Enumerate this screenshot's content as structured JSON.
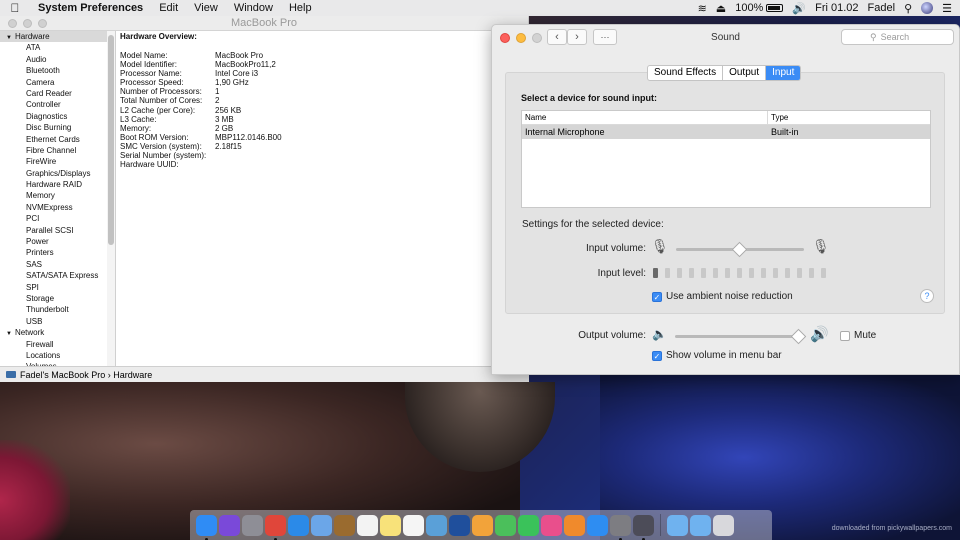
{
  "menubar": {
    "app": "System Preferences",
    "menus": [
      "Edit",
      "View",
      "Window",
      "Help"
    ],
    "battery": "100%",
    "clock": "Fri 01.02",
    "user": "Fadel"
  },
  "sysinfo": {
    "title": "MacBook Pro",
    "sidebar": {
      "hardware_group": "Hardware",
      "hardware_items": [
        "ATA",
        "Audio",
        "Bluetooth",
        "Camera",
        "Card Reader",
        "Controller",
        "Diagnostics",
        "Disc Burning",
        "Ethernet Cards",
        "Fibre Channel",
        "FireWire",
        "Graphics/Displays",
        "Hardware RAID",
        "Memory",
        "NVMExpress",
        "PCI",
        "Parallel SCSI",
        "Power",
        "Printers",
        "SAS",
        "SATA/SATA Express",
        "SPI",
        "Storage",
        "Thunderbolt",
        "USB"
      ],
      "network_group": "Network",
      "network_items": [
        "Firewall",
        "Locations",
        "Volumes"
      ]
    },
    "overview_title": "Hardware Overview:",
    "overview": [
      {
        "k": "Model Name:",
        "v": "MacBook Pro"
      },
      {
        "k": "Model Identifier:",
        "v": "MacBookPro11,2"
      },
      {
        "k": "Processor Name:",
        "v": "Intel Core i3"
      },
      {
        "k": "Processor Speed:",
        "v": "1,90 GHz"
      },
      {
        "k": "Number of Processors:",
        "v": "1"
      },
      {
        "k": "Total Number of Cores:",
        "v": "2"
      },
      {
        "k": "L2 Cache (per Core):",
        "v": "256 KB"
      },
      {
        "k": "L3 Cache:",
        "v": "3 MB"
      },
      {
        "k": "Memory:",
        "v": "2 GB"
      },
      {
        "k": "Boot ROM Version:",
        "v": "MBP112.0146.B00"
      },
      {
        "k": "SMC Version (system):",
        "v": "2.18f15"
      },
      {
        "k": "Serial Number (system):",
        "v": ""
      },
      {
        "k": "Hardware UUID:",
        "v": ""
      }
    ],
    "status_path": "Fadel's MacBook Pro › Hardware"
  },
  "sound": {
    "title": "Sound",
    "search_placeholder": "Search",
    "tabs": [
      "Sound Effects",
      "Output",
      "Input"
    ],
    "active_tab": "Input",
    "heading": "Select a device for sound input:",
    "columns": [
      "Name",
      "Type"
    ],
    "devices": [
      {
        "name": "Internal Microphone",
        "type": "Built-in"
      }
    ],
    "settings_label": "Settings for the selected device:",
    "input_volume_label": "Input volume:",
    "input_volume": 0.5,
    "input_level_label": "Input level:",
    "input_level_segments": 15,
    "input_level_active": 1,
    "ambient_noise_label": "Use ambient noise reduction",
    "ambient_noise_checked": true,
    "output_volume_label": "Output volume:",
    "output_volume": 0.97,
    "mute_label": "Mute",
    "mute_checked": false,
    "show_volume_label": "Show volume in menu bar",
    "show_volume_checked": true
  },
  "dock": {
    "apps": [
      {
        "name": "finder-icon",
        "color": "#2f8cf5",
        "running": true
      },
      {
        "name": "siri-icon",
        "color": "#7a49d9",
        "running": false
      },
      {
        "name": "launchpad-icon",
        "color": "#8e8e96",
        "running": false
      },
      {
        "name": "chrome-icon",
        "color": "#e0463a",
        "running": true
      },
      {
        "name": "safari-icon",
        "color": "#2b8ae8",
        "running": false
      },
      {
        "name": "mail-icon",
        "color": "#6ba6e8",
        "running": false
      },
      {
        "name": "notefile-icon",
        "color": "#9a6b2f",
        "running": false
      },
      {
        "name": "calendar-icon",
        "color": "#f3f3f3",
        "running": false
      },
      {
        "name": "notes-icon",
        "color": "#f8e27a",
        "running": false
      },
      {
        "name": "reminders-icon",
        "color": "#f5f5f5",
        "running": false
      },
      {
        "name": "preview-icon",
        "color": "#5aa0d8",
        "running": false
      },
      {
        "name": "keynote-icon",
        "color": "#1f4f9c",
        "running": false
      },
      {
        "name": "photos-icon",
        "color": "#f2a33a",
        "running": false
      },
      {
        "name": "messages-icon",
        "color": "#4bbf5b",
        "running": false
      },
      {
        "name": "facetime-icon",
        "color": "#3ac25a",
        "running": false
      },
      {
        "name": "itunes-icon",
        "color": "#e94f8c",
        "running": false
      },
      {
        "name": "ibooks-icon",
        "color": "#f08a2c",
        "running": false
      },
      {
        "name": "app-store-icon",
        "color": "#2e8df2",
        "running": false
      },
      {
        "name": "system-preferences-icon",
        "color": "#7d7d82",
        "running": true
      },
      {
        "name": "system-info-icon",
        "color": "#4c4c58",
        "running": true
      }
    ],
    "folders": [
      {
        "name": "applications-folder-icon",
        "color": "#6fb2ef"
      },
      {
        "name": "downloads-folder-icon",
        "color": "#6fb2ef"
      },
      {
        "name": "trash-icon",
        "color": "#d8d8dc"
      }
    ]
  },
  "watermark": "downloaded from pickywallpapers.com"
}
